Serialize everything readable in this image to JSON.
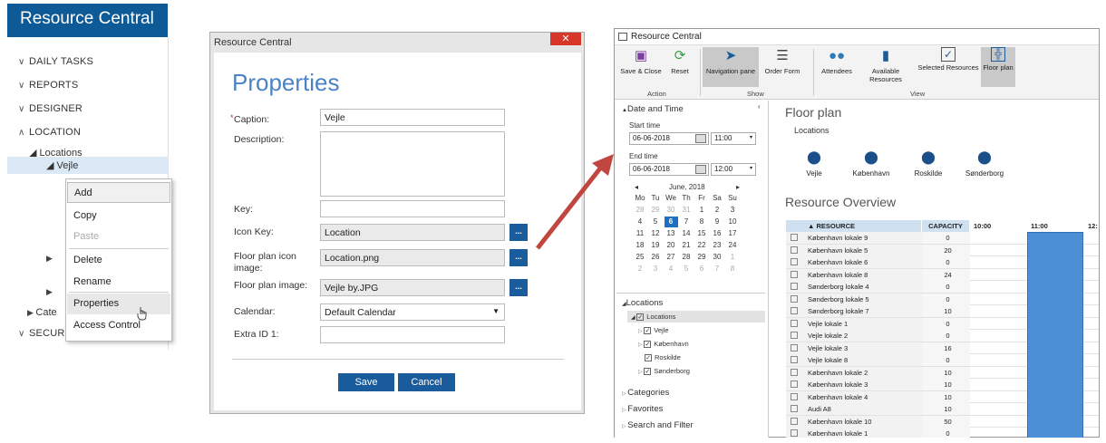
{
  "left": {
    "app_title": "Resource Central",
    "sections": [
      {
        "chev": "∨",
        "label": "DAILY TASKS"
      },
      {
        "chev": "∨",
        "label": "REPORTS"
      },
      {
        "chev": "∨",
        "label": "DESIGNER"
      },
      {
        "chev": "∧",
        "label": "LOCATION"
      }
    ],
    "tree": {
      "locations": "◢ Locations",
      "vejle": "◢ Vejle",
      "categories": "Cate",
      "security": "SECUR"
    },
    "context_menu": [
      "Add",
      "Copy",
      "Paste",
      "Delete",
      "Rename",
      "Properties",
      "Access Control"
    ]
  },
  "dialog": {
    "window_title": "Resource Central",
    "close": "✕",
    "title": "Properties",
    "labels": {
      "caption": "Caption:",
      "description": "Description:",
      "key": "Key:",
      "icon_key": "Icon Key:",
      "floor_icon": "Floor plan icon image:",
      "floor_image": "Floor plan image:",
      "calendar": "Calendar:",
      "extra": "Extra ID 1:"
    },
    "values": {
      "caption": "Vejle",
      "description": "",
      "key": "",
      "icon_key": "Location",
      "floor_icon": "Location.png",
      "floor_image": "Vejle by.JPG",
      "calendar": "Default Calendar",
      "extra": ""
    },
    "dots": "...",
    "save": "Save",
    "cancel": "Cancel",
    "required_mark": "*",
    "dropdown_arrow": "▼"
  },
  "app": {
    "window_title": "Resource Central",
    "ribbon": {
      "save_close": "Save & Close",
      "reset": "Reset",
      "nav_pane": "Navigation pane",
      "order_form": "Order Form",
      "attendees": "Attendees",
      "available": "Available Resources",
      "selected": "Selected Resources",
      "floor_plan": "Floor plan",
      "grp_action": "Action",
      "grp_show": "Show",
      "grp_view": "View"
    },
    "datetime": {
      "header": "Date and Time",
      "start_label": "Start time",
      "start_date": "06-06-2018",
      "start_time": "11:00",
      "end_label": "End time",
      "end_date": "06-06-2018",
      "end_time": "12:00",
      "month": "June, 2018"
    },
    "calendar": {
      "days": [
        "Mo",
        "Tu",
        "We",
        "Th",
        "Fr",
        "Sa",
        "Su"
      ],
      "weeks": [
        [
          "28",
          "29",
          "30",
          "31",
          "1",
          "2",
          "3"
        ],
        [
          "4",
          "5",
          "6",
          "7",
          "8",
          "9",
          "10"
        ],
        [
          "11",
          "12",
          "13",
          "14",
          "15",
          "16",
          "17"
        ],
        [
          "18",
          "19",
          "20",
          "21",
          "22",
          "23",
          "24"
        ],
        [
          "25",
          "26",
          "27",
          "28",
          "29",
          "30",
          "1"
        ],
        [
          "2",
          "3",
          "4",
          "5",
          "6",
          "7",
          "8"
        ]
      ],
      "selected": "6"
    },
    "tree": {
      "header": "Locations",
      "root": "Locations",
      "items": [
        "Vejle",
        "København",
        "Roskilde",
        "Sønderborg"
      ]
    },
    "sections": [
      "Categories",
      "Favorites",
      "Search and Filter"
    ],
    "floor_plan": {
      "title": "Floor plan",
      "subtitle": "Locations",
      "pins": [
        "Vejle",
        "København",
        "Roskilde",
        "Sønderborg"
      ]
    },
    "overview": {
      "title": "Resource Overview",
      "columns": [
        "▲ RESOURCE",
        "CAPACITY",
        "10:00",
        "11:00",
        "12:"
      ],
      "rows": [
        [
          "København lokale 9",
          "0"
        ],
        [
          "København lokale 5",
          "20"
        ],
        [
          "København lokale 6",
          "0"
        ],
        [
          "København lokale 8",
          "24"
        ],
        [
          "Sønderborg lokale 4",
          "0"
        ],
        [
          "Sønderborg lokale 5",
          "0"
        ],
        [
          "Sønderborg lokale 7",
          "10"
        ],
        [
          "Vejle lokale 1",
          "0"
        ],
        [
          "Vejle lokale 2",
          "0"
        ],
        [
          "Vejle lokale 3",
          "16"
        ],
        [
          "Vejle lokale 8",
          "0"
        ],
        [
          "København lokale 2",
          "10"
        ],
        [
          "København lokale 3",
          "10"
        ],
        [
          "København lokale 4",
          "10"
        ],
        [
          "Audi A8",
          "10"
        ],
        [
          "København lokale 10",
          "50"
        ],
        [
          "København lokale 1",
          "0"
        ]
      ]
    }
  },
  "colors": {
    "brand": "#0e5a96",
    "accent": "#1a5b9c",
    "arrow": "#c0463f",
    "highlight": "#4c8fd6"
  }
}
